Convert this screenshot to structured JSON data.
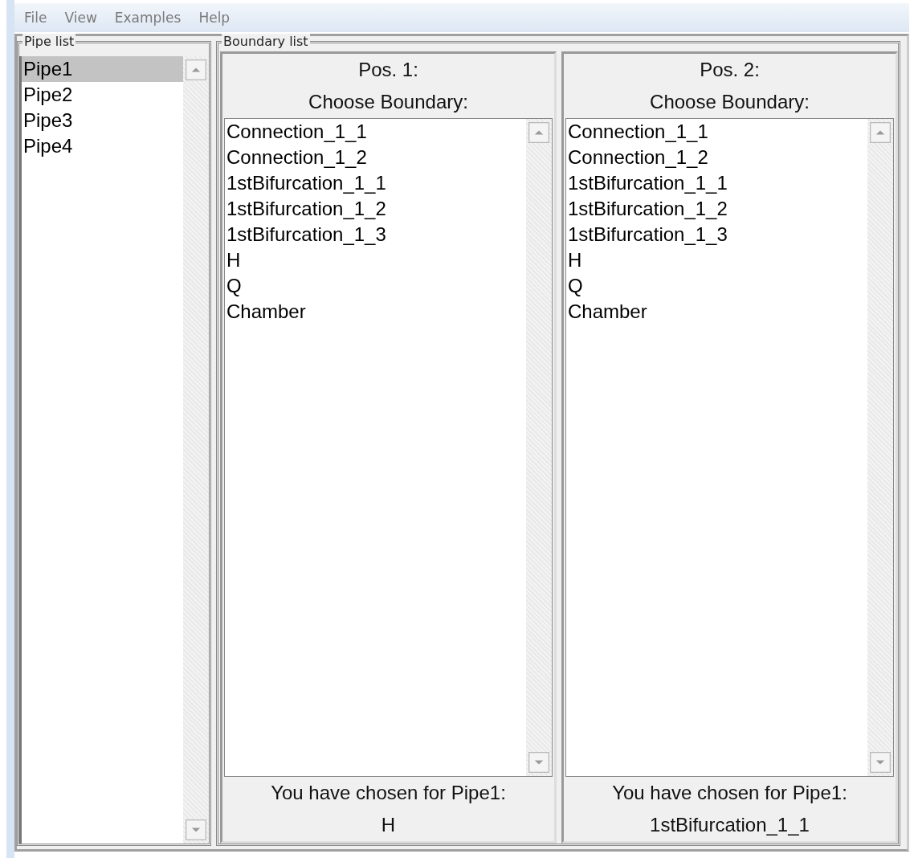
{
  "menu": [
    "File",
    "View",
    "Examples",
    "Help"
  ],
  "pipe_list": {
    "title": "Pipe list",
    "items": [
      {
        "label": "Pipe1",
        "selected": true
      },
      {
        "label": "Pipe2",
        "selected": false
      },
      {
        "label": "Pipe3",
        "selected": false
      },
      {
        "label": "Pipe4",
        "selected": false
      }
    ]
  },
  "boundary_list": {
    "title": "Boundary list",
    "panels": [
      {
        "heading": "Pos. 1:",
        "prompt": "Choose Boundary:",
        "options": [
          {
            "label": "Connection_1_1",
            "selected": false
          },
          {
            "label": "Connection_1_2",
            "selected": false
          },
          {
            "label": "1stBifurcation_1_1",
            "selected": false
          },
          {
            "label": "1stBifurcation_1_2",
            "selected": false
          },
          {
            "label": "1stBifurcation_1_3",
            "selected": false
          },
          {
            "label": "H",
            "selected": false
          },
          {
            "label": "Q",
            "selected": false
          },
          {
            "label": "Chamber",
            "selected": false
          }
        ],
        "chosen_label": "You have chosen for Pipe1:",
        "chosen_value": "H"
      },
      {
        "heading": "Pos. 2:",
        "prompt": "Choose Boundary:",
        "options": [
          {
            "label": "Connection_1_1",
            "selected": false
          },
          {
            "label": "Connection_1_2",
            "selected": false
          },
          {
            "label": "1stBifurcation_1_1",
            "selected": false
          },
          {
            "label": "1stBifurcation_1_2",
            "selected": false
          },
          {
            "label": "1stBifurcation_1_3",
            "selected": false
          },
          {
            "label": "H",
            "selected": false
          },
          {
            "label": "Q",
            "selected": false
          },
          {
            "label": "Chamber",
            "selected": false
          }
        ],
        "chosen_label": "You have chosen for Pipe1:",
        "chosen_value": "1stBifurcation_1_1"
      }
    ]
  }
}
